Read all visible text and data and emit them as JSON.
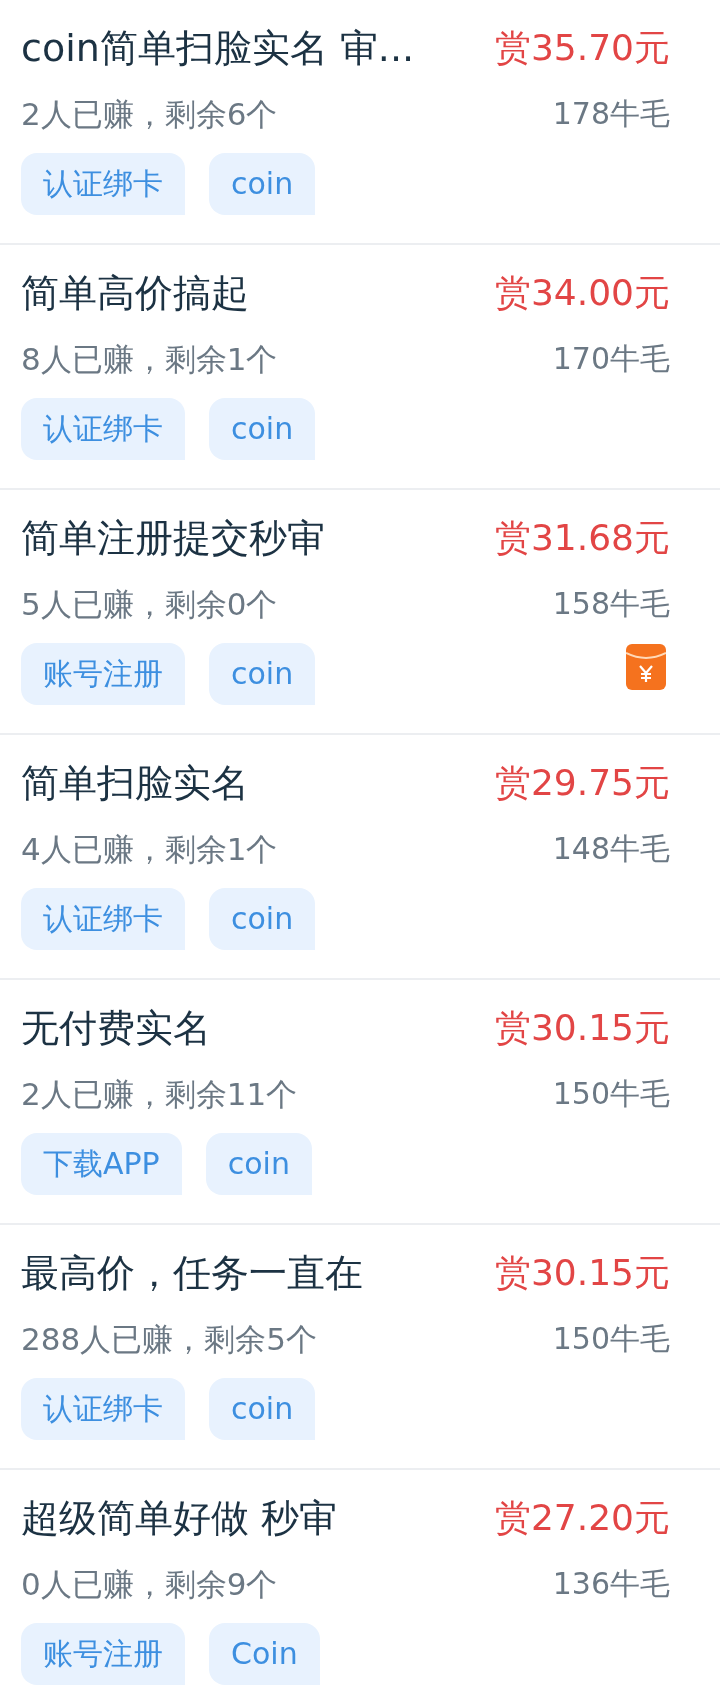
{
  "tasks": [
    {
      "title": "coin简单扫脸实名 审...",
      "reward": "赏35.70元",
      "stats": "2人已赚，剩余6个",
      "points": "178牛毛",
      "tags": [
        "认证绑卡",
        "coin"
      ],
      "red_packet": false
    },
    {
      "title": "简单高价搞起",
      "reward": "赏34.00元",
      "stats": "8人已赚，剩余1个",
      "points": "170牛毛",
      "tags": [
        "认证绑卡",
        "coin"
      ],
      "red_packet": false
    },
    {
      "title": "简单注册提交秒审",
      "reward": "赏31.68元",
      "stats": "5人已赚，剩余0个",
      "points": "158牛毛",
      "tags": [
        "账号注册",
        "coin"
      ],
      "red_packet": true
    },
    {
      "title": "简单扫脸实名",
      "reward": "赏29.75元",
      "stats": "4人已赚，剩余1个",
      "points": "148牛毛",
      "tags": [
        "认证绑卡",
        "coin"
      ],
      "red_packet": false
    },
    {
      "title": "无付费实名",
      "reward": "赏30.15元",
      "stats": "2人已赚，剩余11个",
      "points": "150牛毛",
      "tags": [
        "下载APP",
        "coin"
      ],
      "red_packet": false
    },
    {
      "title": "最高价，任务一直在",
      "reward": "赏30.15元",
      "stats": "288人已赚，剩余5个",
      "points": "150牛毛",
      "tags": [
        "认证绑卡",
        "coin"
      ],
      "red_packet": false
    },
    {
      "title": "超级简单好做 秒审",
      "reward": "赏27.20元",
      "stats": "0人已赚，剩余9个",
      "points": "136牛毛",
      "tags": [
        "账号注册",
        "Coin"
      ],
      "red_packet": false
    }
  ]
}
